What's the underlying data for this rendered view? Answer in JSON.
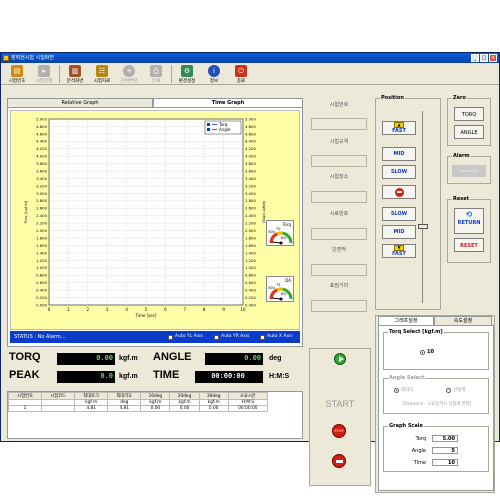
{
  "window": {
    "title": "장력현시험 시험화면"
  },
  "toolbar": [
    {
      "label": "시험번호",
      "icon": "folder-icon",
      "enabled": true,
      "color": "#d08a10"
    },
    {
      "label": "시험진행",
      "icon": "play-doc-icon",
      "enabled": false,
      "color": "#b0b0b0"
    },
    {
      "label": "분석화면",
      "icon": "bar-chart-icon",
      "enabled": true,
      "color": "#a0522d"
    },
    {
      "label": "시험자료",
      "icon": "data-icon",
      "enabled": true,
      "color": "#b8860b"
    },
    {
      "label": "단위변환",
      "icon": "add-icon",
      "enabled": false,
      "color": "#b0b0b0"
    },
    {
      "label": "인쇄",
      "icon": "printer-icon",
      "enabled": false,
      "color": "#b0b0b0"
    },
    {
      "label": "환경설정",
      "icon": "settings-icon",
      "enabled": true,
      "color": "#2e8b57"
    },
    {
      "label": "정보",
      "icon": "info-icon",
      "enabled": true,
      "color": "#1f4fb8"
    },
    {
      "label": "종료",
      "icon": "exit-icon",
      "enabled": true,
      "color": "#d0301a"
    }
  ],
  "tabs": {
    "relative": "Relative Graph",
    "time": "Time Graph"
  },
  "chart_data": {
    "type": "line",
    "xlabel": "Time [sec]",
    "ylabel_left": "Torq [kgf.m]",
    "ylabel_right": "Angle [deg]",
    "x_ticks": [
      "0",
      "1",
      "2",
      "3",
      "4",
      "5",
      "6",
      "7",
      "8",
      "9",
      "10"
    ],
    "y_left_ticks": [
      "5.000",
      "4.800",
      "4.600",
      "4.400",
      "4.200",
      "4.000",
      "3.800",
      "3.600",
      "3.400",
      "3.200",
      "3.000",
      "2.800",
      "2.600",
      "2.400",
      "2.200",
      "2.000",
      "1.800",
      "1.600",
      "1.400",
      "1.200",
      "1.000",
      "0.800",
      "0.600",
      "0.400",
      "0.200",
      "0.000"
    ],
    "y_right_ticks": [
      "5.000",
      "4.800",
      "4.600",
      "4.400",
      "4.200",
      "4.000",
      "3.800",
      "3.600",
      "3.400",
      "3.200",
      "3.000",
      "2.800",
      "2.600",
      "2.400",
      "2.200",
      "2.000",
      "1.800",
      "1.600",
      "1.400",
      "1.200",
      "1.000",
      "0.800",
      "0.600",
      "0.400",
      "0.200",
      "0.000"
    ],
    "xlim": [
      0,
      10
    ],
    "ylim": [
      0,
      5
    ],
    "grid": true,
    "legend_position": "top-right",
    "series": [
      {
        "name": "Torq",
        "values": []
      },
      {
        "name": "Angle",
        "values": []
      }
    ]
  },
  "gauges": [
    {
      "title": "Torq",
      "value": "0",
      "ticks": [
        "500",
        "70",
        "25",
        "6%",
        "3"
      ]
    },
    {
      "title": "DA",
      "value": "0",
      "ticks": [
        "500",
        "75",
        "25",
        "6%",
        "3"
      ]
    }
  ],
  "status": {
    "text": "STATUS : No Alarm...",
    "auto_y_left": "Auto YL Axis",
    "auto_y_right": "Auto YR Axis",
    "auto_x": "Auto X Axis"
  },
  "readouts": {
    "torq_label": "TORQ",
    "torq_value": "0.00",
    "torq_unit": "kgf.m",
    "angle_label": "ANGLE",
    "angle_value": "0.00",
    "angle_unit": "deg",
    "peak_label": "PEAK",
    "peak_value": "0.0",
    "peak_unit": "kgf.m",
    "time_label": "TIME",
    "time_value": "00:00:00",
    "time_unit": "H:M:S"
  },
  "results_table": {
    "headers": [
      "시험번호",
      "시험코드",
      "최대토크",
      "최대각도",
      "10deg",
      "20deg",
      "30deg",
      "소요시간"
    ],
    "units": [
      "",
      "",
      "kgf.m",
      "deg",
      "kgf.m",
      "kgf.m",
      "kgf.m",
      "H:M:S"
    ],
    "rows": [
      [
        "1",
        "",
        "4.81",
        "4.81",
        "0.00",
        "0.00",
        "0.00",
        "00:00:00"
      ]
    ]
  },
  "fields": {
    "test_no": "시험번호",
    "test_spec": "시험규격",
    "test_place": "시험장소",
    "sample_no": "시료번호",
    "section": "단면적",
    "dist": "표점거리"
  },
  "start": {
    "label": "START"
  },
  "stop": {
    "label": "STOP"
  },
  "position": {
    "title": "Position",
    "fast_up": "FAST",
    "mid_up": "MID",
    "slow_up": "SLOW",
    "slow_down": "SLOW",
    "mid_down": "MID",
    "fast_down": "FAST"
  },
  "zero": {
    "title": "Zero",
    "torq": "TORQ",
    "angle": "ANGLE"
  },
  "alarm": {
    "title": "Alarm",
    "text": "Alarm text"
  },
  "reset": {
    "title": "Reset",
    "return": "RETURN",
    "reset": "RESET"
  },
  "settings": {
    "tab_graph": "그래프설정",
    "tab_speed": "속도설정",
    "torq_select_title": "Torq Select [kgf.m]",
    "torq_select_value": "10",
    "angle_select_title": "Angle Select",
    "angle_opt1": "데이터",
    "angle_opt2": "선형계",
    "distance_text": "[Distance : 시료장착시 선형계 안착]",
    "graph_scale_title": "Graph Scale",
    "torq_label": "Torq",
    "torq_value": "5.00",
    "angle_label": "Angle",
    "angle_value": "5",
    "time_label": "Time",
    "time_value": "10"
  }
}
